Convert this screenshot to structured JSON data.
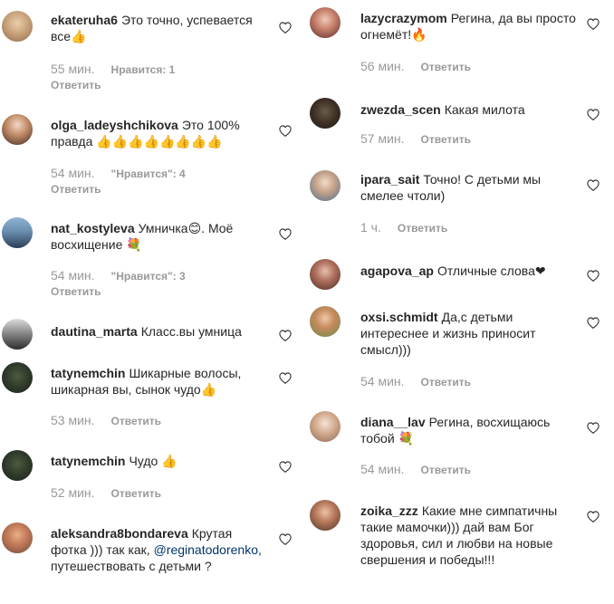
{
  "colors": {
    "text": "#262626",
    "muted": "#999999",
    "mention": "#003569",
    "heart": "#262626"
  },
  "left_comments": [
    {
      "username": "ekateruha6",
      "text": "Это точно, успевается все👍",
      "time": "55 мин.",
      "likes": "Нравится: 1",
      "reply": "Ответить"
    },
    {
      "username": "olga_ladeyshchikova",
      "text": "Это 100% правда 👍👍👍👍👍👍👍👍",
      "time": "54 мин.",
      "likes": "\"Нравится\": 4",
      "reply": "Ответить"
    },
    {
      "username": "nat_kostyleva",
      "text": "Умничка😊. Моё восхищение 💐",
      "time": "54 мин.",
      "likes": "\"Нравится\": 3",
      "reply": "Ответить"
    },
    {
      "username": "dautina_marta",
      "text": "Класс.вы умница",
      "time": "",
      "likes": "",
      "reply": ""
    },
    {
      "username": "tatynemchin",
      "text": "Шикарные волосы, шикарная вы, сынок чудо👍",
      "time": "53 мин.",
      "likes": "",
      "reply": "Ответить"
    },
    {
      "username": "tatynemchin",
      "text": "Чудо 👍",
      "time": "52 мин.",
      "likes": "",
      "reply": "Ответить"
    },
    {
      "username": "aleksandra8bondareva",
      "text": "Крутая фотка ))) так как,",
      "mention": "@reginatodorenko",
      "text_after": ", путешествовать с детьми ?",
      "time": "",
      "likes": "",
      "reply": ""
    }
  ],
  "right_comments": [
    {
      "username": "lazycrazymom",
      "text": "Регина, да вы просто огнемёт!🔥",
      "time": "56 мин.",
      "reply": "Ответить"
    },
    {
      "username": "zwezda_scen",
      "text": "Какая милота",
      "time": "57 мин.",
      "reply": "Ответить"
    },
    {
      "username": "ipara_sait",
      "text": "Точно! С детьми мы смелее чтоли)",
      "time": "1 ч.",
      "reply": "Ответить"
    },
    {
      "username": "agapova_ap",
      "text": "Отличные слова❤",
      "time": "",
      "reply": ""
    },
    {
      "username": "oxsi.schmidt",
      "text": "Да,с детьми интереснее и жизнь приносит смысл)))",
      "time": "54 мин.",
      "reply": "Ответить"
    },
    {
      "username": "diana__lav",
      "text": "Регина, восхищаюсь тобой 💐",
      "time": "54 мин.",
      "reply": "Ответить"
    },
    {
      "username": "zoika_zzz",
      "text": "Какие мне симпатичны такие мамочки))) дай вам Бог здоровья, сил и любви на новые свершения и победы!!!",
      "time": "",
      "reply": ""
    }
  ]
}
